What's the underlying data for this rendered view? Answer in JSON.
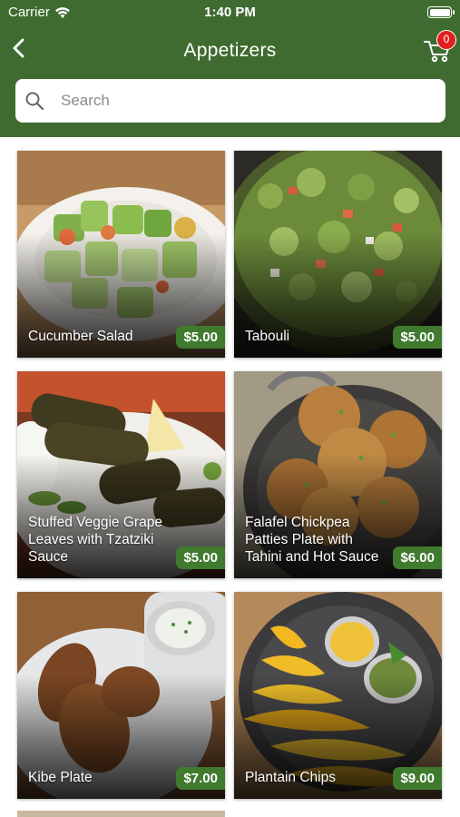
{
  "status_bar": {
    "carrier": "Carrier",
    "time": "1:40 PM"
  },
  "nav": {
    "title": "Appetizers",
    "cart_count": "0"
  },
  "search": {
    "placeholder": "Search",
    "value": ""
  },
  "items": [
    {
      "name": "Cucumber Salad",
      "price": "$5.00"
    },
    {
      "name": "Tabouli",
      "price": "$5.00"
    },
    {
      "name": "Stuffed Veggie Grape Leaves with Tzatziki Sauce",
      "price": "$5.00"
    },
    {
      "name": "Falafel Chickpea Patties Plate with Tahini and Hot Sauce",
      "price": "$6.00"
    },
    {
      "name": "Kibe Plate",
      "price": "$7.00"
    },
    {
      "name": "Plantain Chips",
      "price": "$9.00"
    }
  ],
  "colors": {
    "header": "#3f6b30",
    "price_tag": "#3f7a2e",
    "badge": "#e02020"
  },
  "icons": [
    "wifi-icon",
    "battery-icon",
    "back-chevron-icon",
    "cart-icon",
    "search-icon"
  ]
}
